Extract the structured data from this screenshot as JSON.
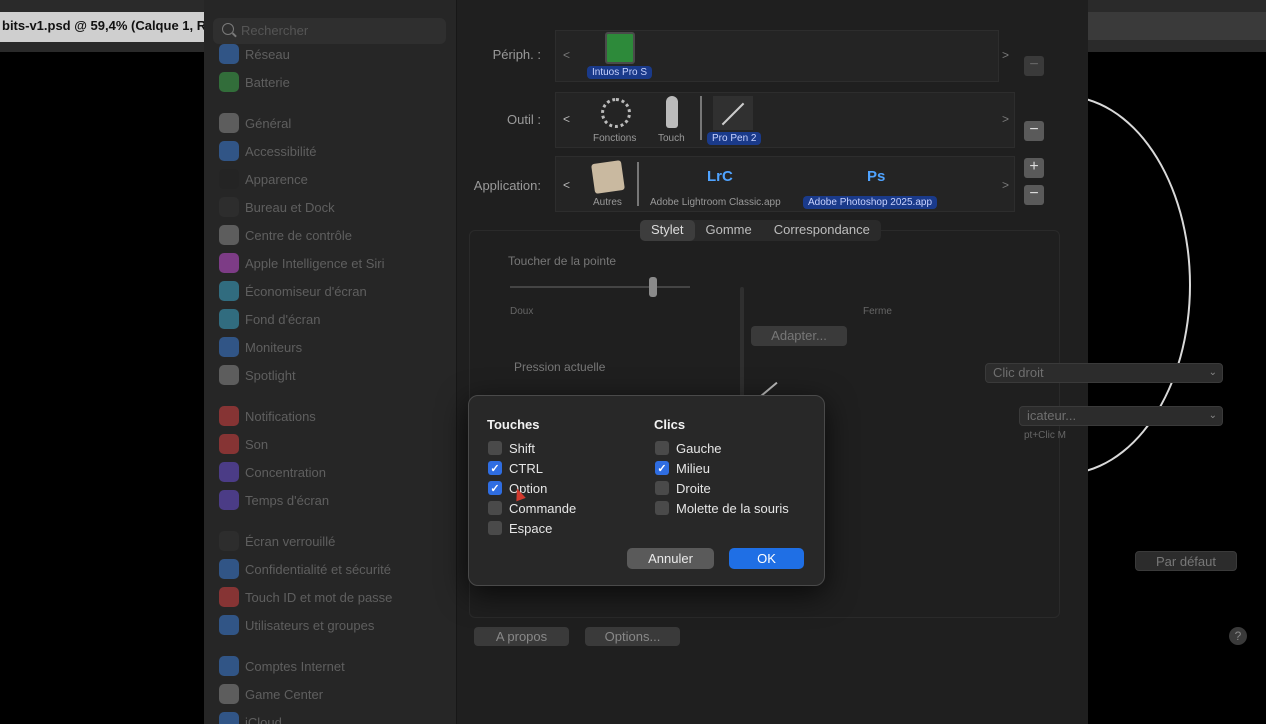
{
  "photoshop": {
    "doc_tab": "bits-v1.psd @ 59,4% (Calque 1, R"
  },
  "sidebar": {
    "search_placeholder": "Rechercher",
    "items": [
      {
        "label": "Réseau",
        "color": "#3b7bd6"
      },
      {
        "label": "Batterie",
        "color": "#3da84a"
      },
      {
        "label": "Général",
        "color": "#8a8a8a"
      },
      {
        "label": "Accessibilité",
        "color": "#3b7bd6"
      },
      {
        "label": "Apparence",
        "color": "#222222"
      },
      {
        "label": "Bureau et Dock",
        "color": "#333333"
      },
      {
        "label": "Centre de contrôle",
        "color": "#8a8a8a"
      },
      {
        "label": "Apple Intelligence et Siri",
        "color": "#c44fd6"
      },
      {
        "label": "Économiseur d'écran",
        "color": "#3aa6c9"
      },
      {
        "label": "Fond d'écran",
        "color": "#3aa6c9"
      },
      {
        "label": "Moniteurs",
        "color": "#3b7bd6"
      },
      {
        "label": "Spotlight",
        "color": "#8a8a8a"
      },
      {
        "label": "Notifications",
        "color": "#d64040"
      },
      {
        "label": "Son",
        "color": "#d64040"
      },
      {
        "label": "Concentration",
        "color": "#6a4fd6"
      },
      {
        "label": "Temps d'écran",
        "color": "#6a4fd6"
      },
      {
        "label": "Écran verrouillé",
        "color": "#333333"
      },
      {
        "label": "Confidentialité et sécurité",
        "color": "#3b7bd6"
      },
      {
        "label": "Touch ID et mot de passe",
        "color": "#d64040"
      },
      {
        "label": "Utilisateurs et groupes",
        "color": "#3b7bd6"
      },
      {
        "label": "Comptes Internet",
        "color": "#3b7bd6"
      },
      {
        "label": "Game Center",
        "color": "#8a8a8a"
      },
      {
        "label": "iCloud",
        "color": "#3b7bd6"
      }
    ]
  },
  "wacom": {
    "periph_label": "Périph. :",
    "periph_device": "Intuos Pro S",
    "outil_label": "Outil :",
    "tools": [
      "Fonctions",
      "Touch",
      "Pro Pen 2"
    ],
    "application_label": "Application:",
    "apps": [
      "Autres",
      "Adobe Lightroom Classic.app",
      "Adobe Photoshop 2025.app"
    ],
    "app_icon_lrc": "LrC",
    "app_icon_ps": "Ps",
    "nav_prev": "<",
    "nav_next": ">",
    "plus": "+",
    "minus": "−",
    "tabs": [
      "Stylet",
      "Gomme",
      "Correspondance"
    ],
    "toucher_title": "Toucher de la pointe",
    "doux": "Doux",
    "ferme": "Ferme",
    "adapter": "Adapter...",
    "pression": "Pression actuelle",
    "dropdown1": "Clic droit",
    "dropdown2": "icateur...",
    "shortcut": "pt+Clic M",
    "par_defaut": "Par défaut",
    "a_propos": "A propos",
    "options": "Options...",
    "help": "?"
  },
  "dialog": {
    "touches_title": "Touches",
    "clics_title": "Clics",
    "touches": [
      {
        "label": "Shift",
        "checked": false
      },
      {
        "label": "CTRL",
        "checked": true
      },
      {
        "label": "Option",
        "checked": true
      },
      {
        "label": "Commande",
        "checked": false
      },
      {
        "label": "Espace",
        "checked": false
      }
    ],
    "clics": [
      {
        "label": "Gauche",
        "checked": false
      },
      {
        "label": "Milieu",
        "checked": true
      },
      {
        "label": "Droite",
        "checked": false
      },
      {
        "label": "Molette de la souris",
        "checked": false
      }
    ],
    "cancel": "Annuler",
    "ok": "OK",
    "checkmark": "✓"
  }
}
